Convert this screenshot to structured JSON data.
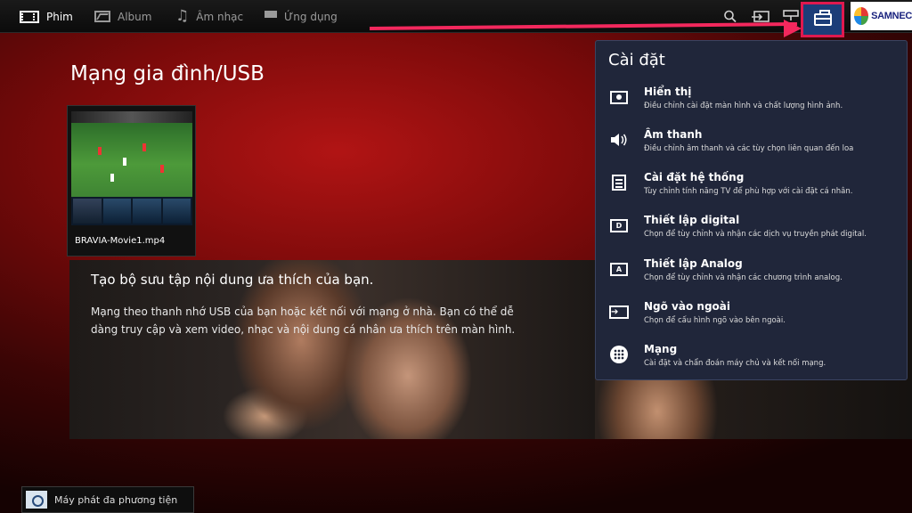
{
  "topbar": {
    "nav": [
      {
        "label": "Phim",
        "icon": "film-icon",
        "active": true
      },
      {
        "label": "Album",
        "icon": "photo-icon",
        "active": false
      },
      {
        "label": "Âm nhạc",
        "icon": "music-icon",
        "active": false
      },
      {
        "label": "Ứng dụng",
        "icon": "apps-icon",
        "active": false
      }
    ],
    "right_icons": [
      "search-icon",
      "input-source-icon",
      "network-icon",
      "settings-toolbox-icon"
    ],
    "logo_text": "SAMNEC"
  },
  "accent_colors": {
    "highlight": "#e0194f",
    "arrow": "#f2285d",
    "panel_bg": "#20263a",
    "selected_icon_bg": "#1c3d78"
  },
  "page": {
    "title": "Mạng gia đình/USB",
    "thumbnail": {
      "filename": "BRAVIA-Movie1.mp4"
    },
    "banner": {
      "title": "Tạo bộ sưu tập nội dung ưa thích của bạn.",
      "description": "Mạng theo thanh nhớ USB của bạn hoặc kết nối với mạng ở nhà. Bạn có thể dễ dàng truy cập và xem video, nhạc và nội dung cá nhân ưa thích trên màn hình."
    }
  },
  "settings_panel": {
    "title": "Cài đặt",
    "items": [
      {
        "label": "Hiển thị",
        "desc": "Điều chỉnh cài đặt màn hình và chất lượng hình ảnh.",
        "icon": "display-icon"
      },
      {
        "label": "Âm thanh",
        "desc": "Điều chỉnh âm thanh và các tùy chọn liên quan đến loa",
        "icon": "speaker-icon"
      },
      {
        "label": "Cài đặt hệ thống",
        "desc": "Tùy chỉnh tính năng TV để phù hợp với cài đặt cá nhân.",
        "icon": "system-settings-icon"
      },
      {
        "label": "Thiết lập digital",
        "desc": "Chọn để tùy chỉnh và nhận các dịch vụ truyền phát digital.",
        "icon": "digital-tv-icon"
      },
      {
        "label": "Thiết lập Analog",
        "desc": "Chọn để tùy chỉnh và nhận các chương trình analog.",
        "icon": "analog-tv-icon"
      },
      {
        "label": "Ngõ vào ngoài",
        "desc": "Chọn để cấu hình ngõ vào bên ngoài.",
        "icon": "external-input-icon"
      },
      {
        "label": "Mạng",
        "desc": "Cài đặt và chẩn đoán máy chủ và kết nối mạng.",
        "icon": "network-globe-icon"
      }
    ]
  },
  "player_bar": {
    "label": "Máy phát đa phương tiện",
    "icon": "media-player-icon"
  }
}
